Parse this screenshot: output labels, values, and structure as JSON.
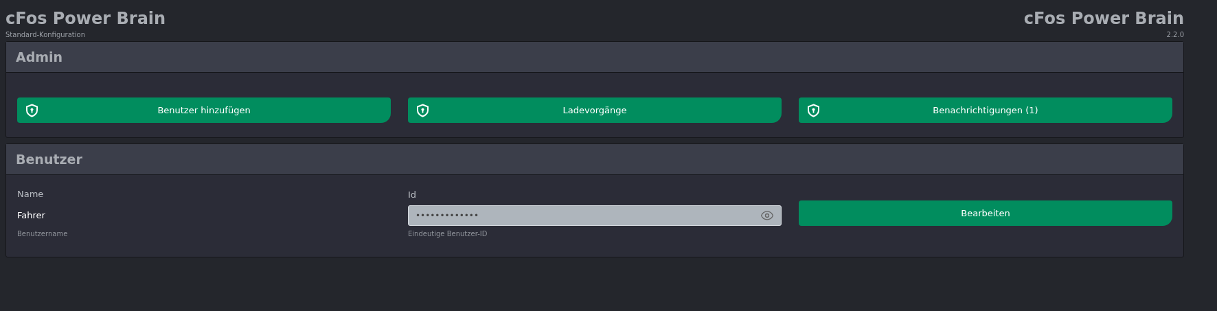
{
  "header": {
    "title": "cFos Power Brain",
    "subtitle": "Standard-Konfiguration",
    "brand": "cFos Power Brain",
    "version": "2.2.0"
  },
  "admin": {
    "title": "Admin",
    "buttons": [
      {
        "label": "Benutzer hinzufügen",
        "kind": "secured"
      },
      {
        "label": "Ladevorgänge",
        "kind": "secured"
      },
      {
        "label": "Benachrichtigungen (1)",
        "kind": "secured"
      }
    ]
  },
  "user": {
    "title": "Benutzer",
    "name": {
      "label": "Name",
      "value": "Fahrer",
      "help": "Benutzername"
    },
    "id": {
      "label": "Id",
      "value": "•••••••••••••",
      "help": "Eindeutige Benutzer-ID"
    },
    "button": "Bearbeiten"
  }
}
